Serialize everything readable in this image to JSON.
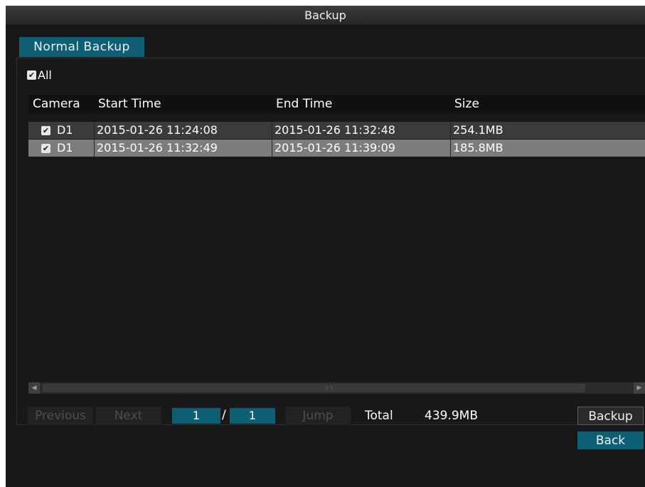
{
  "window": {
    "title": "Backup"
  },
  "tabs": [
    {
      "label": "Normal Backup",
      "active": true
    }
  ],
  "select_all": {
    "label": "All",
    "checked": true
  },
  "table": {
    "columns": [
      "Camera",
      "Start Time",
      "End Time",
      "Size"
    ],
    "rows": [
      {
        "checked": true,
        "camera": "D1",
        "start": "2015-01-26 11:24:08",
        "end": "2015-01-26 11:32:48",
        "size": "254.1MB",
        "selected": false
      },
      {
        "checked": true,
        "camera": "D1",
        "start": "2015-01-26 11:32:49",
        "end": "2015-01-26 11:39:09",
        "size": "185.8MB",
        "selected": true
      }
    ]
  },
  "pagination": {
    "previous_label": "Previous",
    "next_label": "Next",
    "current_page": "1",
    "separator": "/",
    "total_pages": "1",
    "jump_label": "Jump"
  },
  "total": {
    "label": "Total",
    "value": "439.9MB"
  },
  "buttons": {
    "backup_label": "Backup",
    "back_label": "Back"
  },
  "icons": {
    "checkbox": "checkmark-icon",
    "scroll_left": "arrow-left-icon",
    "scroll_right": "arrow-right-icon"
  },
  "colors": {
    "accent": "#0e5f74",
    "selected_row": "#7c7c7c",
    "row": "#3b3b3b",
    "background": "#181818"
  }
}
